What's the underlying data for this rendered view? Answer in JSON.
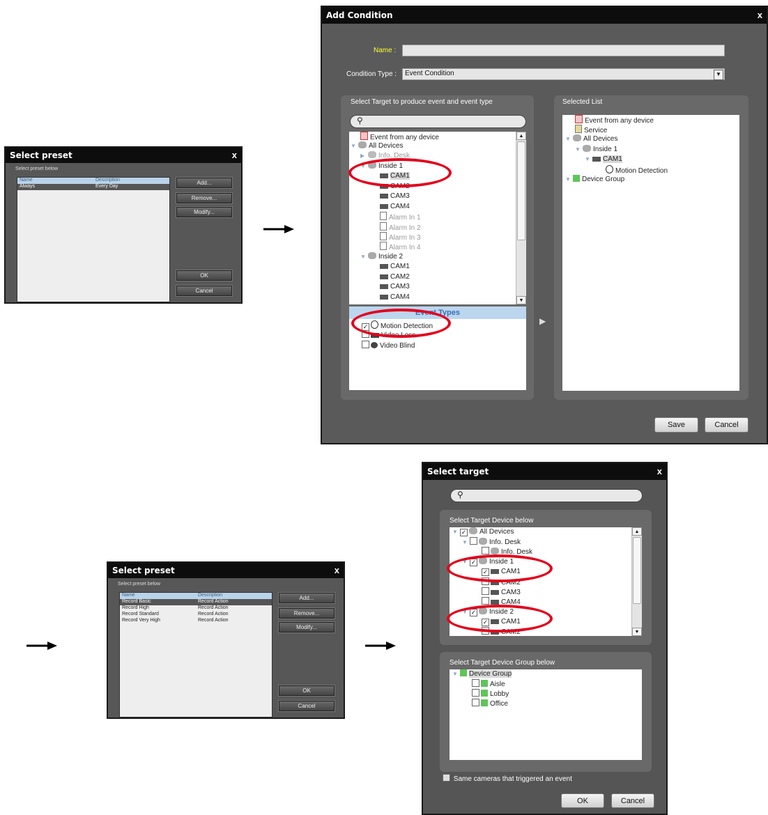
{
  "preset1": {
    "title": "Select preset",
    "close": "x",
    "subtitle": "Select preset below",
    "columns": [
      "Name",
      "Description"
    ],
    "rows": [
      {
        "name": "Always",
        "desc": "Every Day"
      }
    ],
    "buttons": {
      "add": "Add...",
      "remove": "Remove...",
      "modify": "Modify...",
      "ok": "OK",
      "cancel": "Cancel"
    }
  },
  "preset2": {
    "title": "Select preset",
    "close": "x",
    "subtitle": "Select preset below",
    "columns": [
      "Name",
      "Description"
    ],
    "rows": [
      {
        "name": "Record Basic",
        "desc": "Record Action"
      },
      {
        "name": "Record High",
        "desc": "Record Action"
      },
      {
        "name": "Record Standard",
        "desc": "Record Action"
      },
      {
        "name": "Record Very High",
        "desc": "Record Action"
      }
    ],
    "buttons": {
      "add": "Add...",
      "remove": "Remove...",
      "modify": "Modify...",
      "ok": "OK",
      "cancel": "Cancel"
    }
  },
  "add_condition": {
    "title": "Add Condition",
    "close": "x",
    "name_label": "Name :",
    "name_value": "",
    "type_label": "Condition Type :",
    "type_value": "Event Condition",
    "left_panel_label": "Select Target to produce event and event type",
    "right_panel_label": "Selected List",
    "tree": [
      "Event from any device",
      "All Devices",
      "Info. Desk",
      "Inside 1",
      "CAM1",
      "CAM2",
      "CAM3",
      "CAM4",
      "Alarm In 1",
      "Alarm In 2",
      "Alarm In 3",
      "Alarm In 4",
      "Inside 2",
      "CAM1",
      "CAM2",
      "CAM3",
      "CAM4"
    ],
    "event_types_header": "Event Types",
    "event_types": [
      "Motion Detection",
      "Video Loss",
      "Video Blind"
    ],
    "selected": [
      "Event from any device",
      "Service",
      "All Devices",
      "Inside 1",
      "CAM1",
      "Motion Detection",
      "Device Group"
    ],
    "save": "Save",
    "cancel": "Cancel"
  },
  "select_target": {
    "title": "Select target",
    "close": "x",
    "device_label": "Select Target Device below",
    "device_tree": [
      "All Devices",
      "Info. Desk",
      "Info. Desk",
      "Inside 1",
      "CAM1",
      "CAM2",
      "CAM3",
      "CAM4",
      "Inside 2",
      "CAM1",
      "CAM2"
    ],
    "group_label": "Select Target Device Group below",
    "group_tree": [
      "Device Group",
      "Aisle",
      "Lobby",
      "Office"
    ],
    "same_cameras": "Same cameras that triggered an event",
    "ok": "OK",
    "cancel": "Cancel"
  },
  "colors": {
    "highlight": "#e3001b",
    "dialog_bg": "#575757",
    "title_bg": "#0d0d0d"
  }
}
